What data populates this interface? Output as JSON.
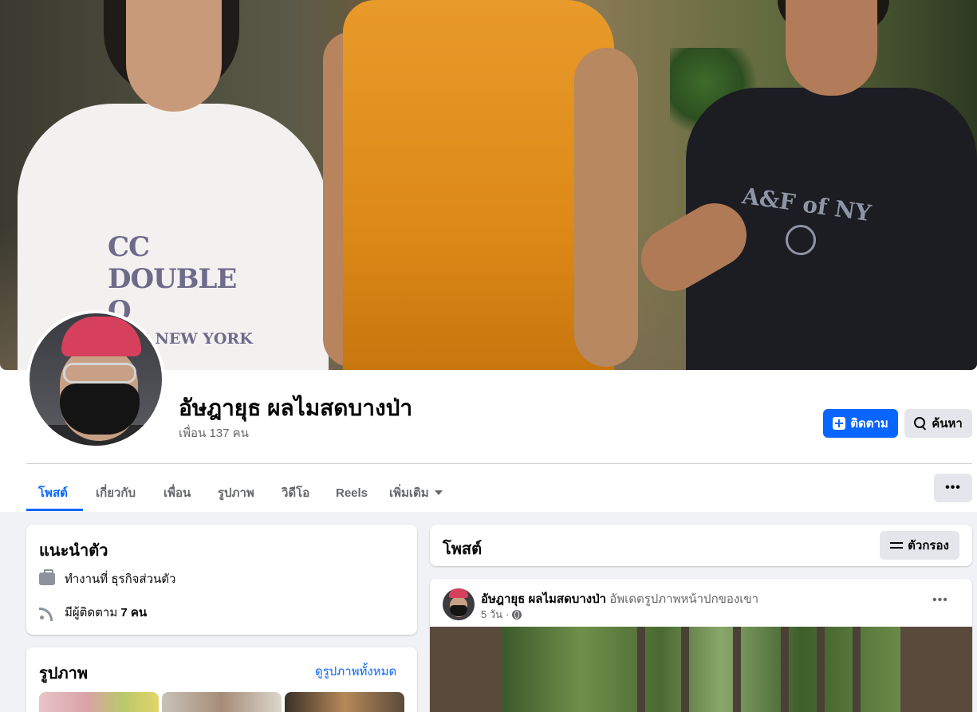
{
  "profile": {
    "name": "อัษฎายุธ ผลไมสดบางป่า",
    "friends": "เพื่อน 137 คน",
    "follow_label": "ติดตาม",
    "search_label": "ค้นหา",
    "more_label": "•••"
  },
  "cover": {
    "shirt_left_line1": "CC DOUBLE O",
    "shirt_left_line2": "1965 NEW YORK",
    "shirt_right": "A&F of NY"
  },
  "tabs": [
    {
      "label": "โพสต์",
      "active": true
    },
    {
      "label": "เกี่ยวกับ",
      "active": false
    },
    {
      "label": "เพื่อน",
      "active": false
    },
    {
      "label": "รูปภาพ",
      "active": false
    },
    {
      "label": "วิดีโอ",
      "active": false
    },
    {
      "label": "Reels",
      "active": false
    },
    {
      "label": "เพิ่มเติม",
      "active": false
    }
  ],
  "intro": {
    "title": "แนะนำตัว",
    "work": "ทำงานที่ ธุรกิจส่วนตัว",
    "followers_prefix": "มีผู้ติดตาม ",
    "followers_count": "7 คน"
  },
  "photos": {
    "title": "รูปภาพ",
    "see_all": "ดูรูปภาพทั้งหมด"
  },
  "posts": {
    "title": "โพสต์",
    "filter_label": "ตัวกรอง",
    "items": [
      {
        "author": "อัษฎายุธ ผลไมสดบางป่า",
        "action": "อัพเดตรูปภาพหน้าปกของเขา",
        "time": "5 วัน",
        "separator": "·",
        "dots": "•••"
      }
    ]
  },
  "colors": {
    "accent": "#0866ff",
    "background": "#f0f2f5",
    "text_secondary": "#65676b"
  }
}
